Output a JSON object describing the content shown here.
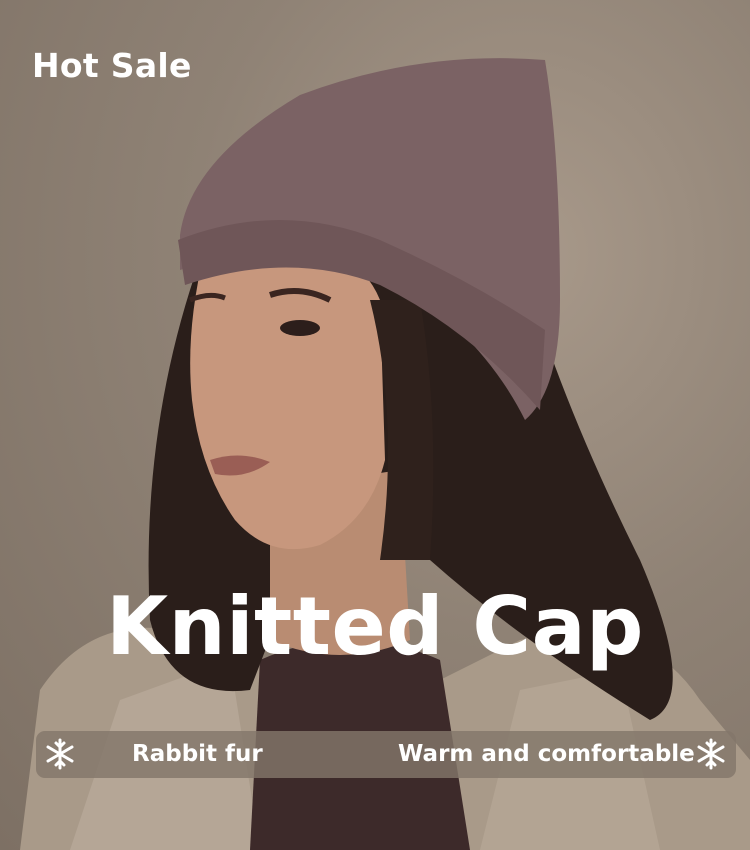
{
  "banner": {
    "corner_label": "Hot Sale",
    "title": "Knitted Cap",
    "features": [
      "Rabbit fur",
      "Warm and comfortable"
    ]
  },
  "icons": {
    "feature_icon": "snowflake-icon"
  },
  "colors": {
    "background": "#8f8275",
    "hat": "#7b6264",
    "text": "#ffffff",
    "feature_bar": "#82766a"
  }
}
